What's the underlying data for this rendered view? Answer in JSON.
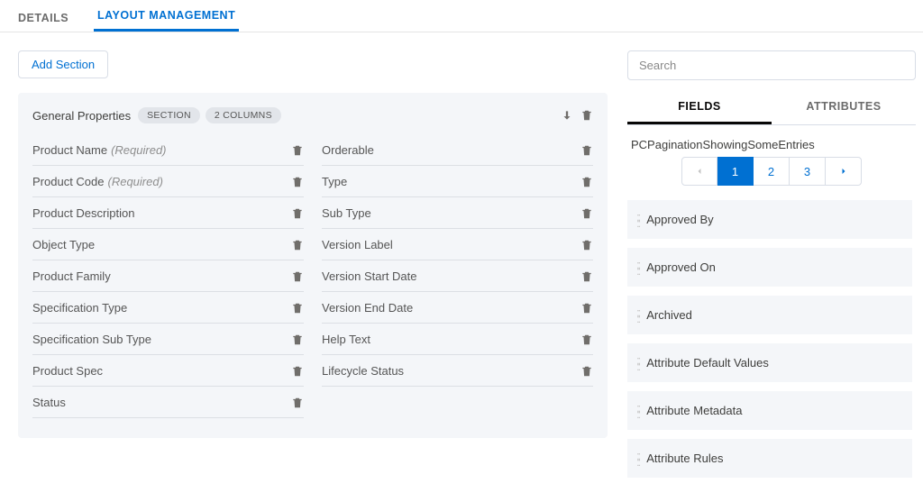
{
  "top_tabs": {
    "details": "Details",
    "layout": "Layout Management"
  },
  "add_section": "Add Section",
  "section": {
    "title": "General Properties",
    "badge_section": "Section",
    "badge_cols": "2 Columns"
  },
  "left_fields": [
    {
      "label": "Product Name",
      "required": true
    },
    {
      "label": "Product Code",
      "required": true
    },
    {
      "label": "Product Description",
      "required": false
    },
    {
      "label": "Object Type",
      "required": false
    },
    {
      "label": "Product Family",
      "required": false
    },
    {
      "label": "Specification Type",
      "required": false
    },
    {
      "label": "Specification Sub Type",
      "required": false
    },
    {
      "label": "Product Spec",
      "required": false
    },
    {
      "label": "Status",
      "required": false
    }
  ],
  "right_fields": [
    "Orderable",
    "Type",
    "Sub Type",
    "Version Label",
    "Version Start Date",
    "Version End Date",
    "Help Text",
    "Lifecycle Status"
  ],
  "required_suffix": "(Required)",
  "sidebar": {
    "search_placeholder": "Search",
    "tabs": {
      "fields": "Fields",
      "attributes": "Attributes"
    },
    "pagination_label": "PCPaginationShowingSomeEntries",
    "pages": [
      "1",
      "2",
      "3"
    ],
    "active_page": "1",
    "available": [
      "Approved By",
      "Approved On",
      "Archived",
      "Attribute Default Values",
      "Attribute Metadata",
      "Attribute Rules"
    ]
  }
}
